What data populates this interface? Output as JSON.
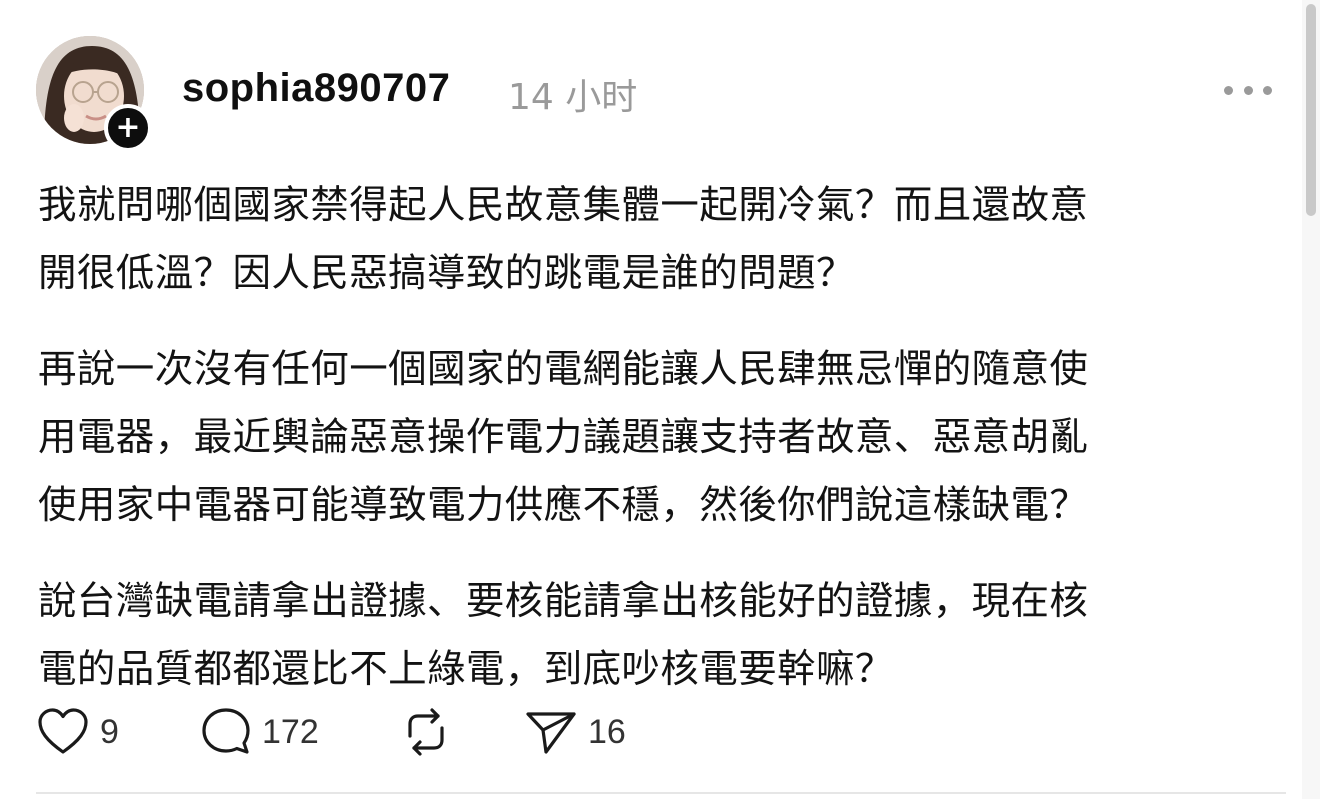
{
  "post": {
    "author": {
      "username": "sophia890707",
      "avatar_icon": "avatar-photo",
      "follow_icon": "plus-icon",
      "follow_label": "+"
    },
    "timestamp": "14 小时",
    "more_icon": "more-horizontal-icon",
    "paragraphs": [
      {
        "lines": [
          "我就問哪個國家禁得起人民故意集體一起開冷氣？而且還故意",
          "開很低溫？因人民惡搞導致的跳電是誰的問題？"
        ]
      },
      {
        "lines": [
          "再說一次沒有任何一個國家的電網能讓人民肆無忌憚的隨意使",
          "用電器，最近輿論惡意操作電力議題讓支持者故意、惡意胡亂",
          "使用家中電器可能導致電力供應不穩，然後你們說這樣缺電？"
        ]
      },
      {
        "lines": [
          "說台灣缺電請拿出證據、要核能請拿出核能好的證據，現在核",
          "電的品質都都還比不上綠電，到底吵核電要幹嘛？"
        ]
      }
    ]
  },
  "actions": {
    "like": {
      "icon": "heart-icon",
      "count": "9"
    },
    "comment": {
      "icon": "comment-icon",
      "count": "172"
    },
    "repost": {
      "icon": "repost-icon",
      "count": ""
    },
    "share": {
      "icon": "send-icon",
      "count": "16"
    }
  },
  "colors": {
    "text": "#131313",
    "muted": "#9a9a9a",
    "badge": "#0d0d0d"
  }
}
